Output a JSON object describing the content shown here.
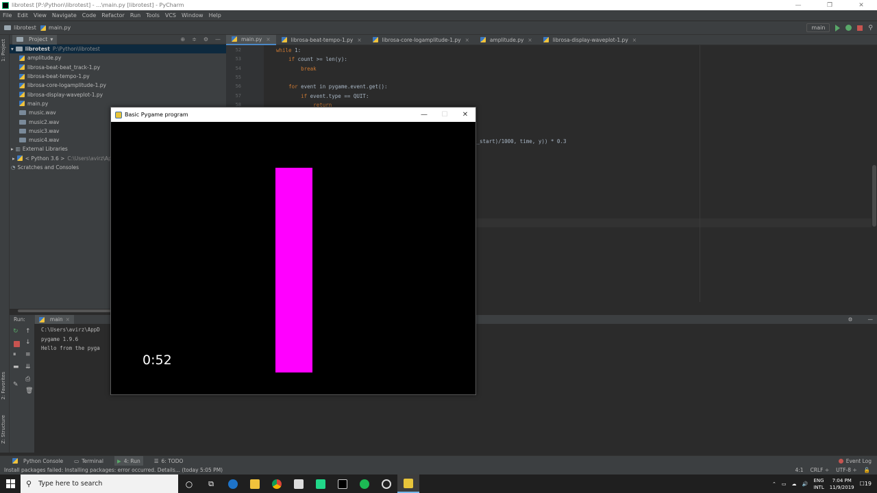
{
  "window": {
    "title": "librotest [P:\\Python\\librotest] - ...\\main.py [librotest] - PyCharm",
    "min": "—",
    "max": "❐",
    "close": "✕"
  },
  "menu": [
    "File",
    "Edit",
    "View",
    "Navigate",
    "Code",
    "Refactor",
    "Run",
    "Tools",
    "VCS",
    "Window",
    "Help"
  ],
  "nav": {
    "project": "librotest",
    "file": "main.py",
    "run_config": "main"
  },
  "side_labels": {
    "project": "1: Project",
    "favorites": "2: Favorites",
    "structure": "Z: Structure"
  },
  "project_panel": {
    "header": "Project",
    "root": {
      "name": "librotest",
      "path": "P:\\Python\\librotest"
    },
    "files": [
      "amplitude.py",
      "librosa-beat-beat_track-1.py",
      "librosa-beat-tempo-1.py",
      "librosa-core-logamplitude-1.py",
      "librosa-display-waveplot-1.py",
      "main.py",
      "music.wav",
      "music2.wav",
      "music3.wav",
      "music4.wav"
    ],
    "external": "External Libraries",
    "python": {
      "name": "< Python 3.6 >",
      "path": "C:\\Users\\avirz\\App"
    },
    "scratches": "Scratches and Consoles"
  },
  "editor": {
    "tabs": [
      "main.py",
      "librosa-beat-tempo-1.py",
      "librosa-core-logamplitude-1.py",
      "amplitude.py",
      "librosa-display-waveplot-1.py"
    ],
    "lines": [
      {
        "n": "52",
        "pre": "",
        "kw": "while",
        "rest": " 1:"
      },
      {
        "n": "53",
        "pre": "    ",
        "kw": "if",
        "rest": " count >= len(y):"
      },
      {
        "n": "54",
        "pre": "        ",
        "kw": "break",
        "rest": ""
      },
      {
        "n": "55",
        "pre": "",
        "kw": "",
        "rest": ""
      },
      {
        "n": "56",
        "pre": "    ",
        "kw": "for",
        "rest": " event in pygame.event.get():"
      },
      {
        "n": "57",
        "pre": "        ",
        "kw": "if",
        "rest": " event.type == QUIT:"
      },
      {
        "n": "58",
        "pre": "            ",
        "kw": "return",
        "rest": ""
      }
    ],
    "partial_line": "e_start)/1000, time, y)) * 0.3"
  },
  "run_panel": {
    "label": "Run:",
    "tab": "main",
    "output": [
      "C:\\Users\\avirz\\AppD",
      "pygame 1.9.6",
      "Hello from the pyga"
    ]
  },
  "bottom_tools": [
    "Python Console",
    "Terminal",
    "4: Run",
    "6: TODO"
  ],
  "event_log": "Event Log",
  "status": {
    "message": "Install packages failed: Installing packages: error occurred. Details... (today 5:05 PM)",
    "pos": "4:1",
    "crlf": "CRLF ÷",
    "enc": "UTF-8 ÷"
  },
  "taskbar": {
    "search_placeholder": "Type here to search",
    "lang1": "ENG",
    "lang2": "INTL",
    "time": "7:04 PM",
    "date": "11/9/2019",
    "notifications": "19"
  },
  "pygame": {
    "title": "Basic Pygame program",
    "timer": "0:52",
    "bar_color": "#ff00ff",
    "bar_level": 0.75
  }
}
